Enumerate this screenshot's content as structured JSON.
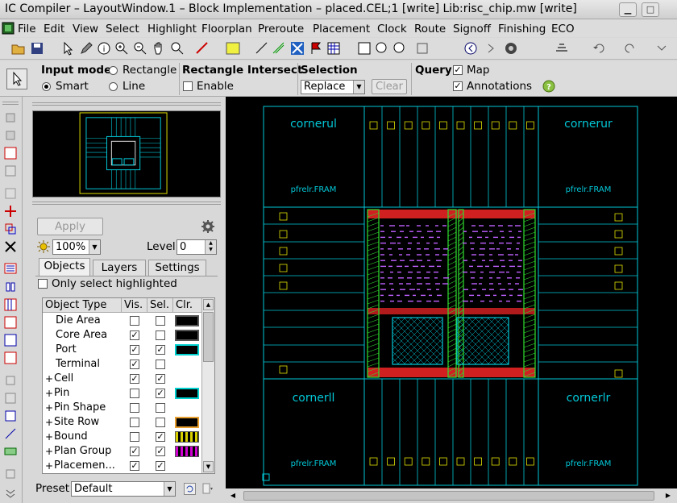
{
  "window": {
    "title": "IC Compiler – LayoutWindow.1 – Block Implementation – placed.CEL;1 [write]     Lib:risc_chip.mw [write]",
    "minimize_icon": "minimize-icon",
    "maximize_icon": "maximize-icon"
  },
  "menu": [
    "File",
    "Edit",
    "View",
    "Select",
    "Highlight",
    "Floorplan",
    "Preroute",
    "Placement",
    "Clock",
    "Route",
    "Signoff",
    "Finishing",
    "ECO"
  ],
  "options": {
    "input_mode_label": "Input mode",
    "rect_label": "Rectangle",
    "smart_label": "Smart",
    "line_label": "Line",
    "rect_intersect_label": "Rectangle Intersect",
    "enable_label": "Enable",
    "selection_label": "Selection",
    "selection_value": "Replace",
    "clear_label": "Clear",
    "query_label": "Query",
    "map_label": "Map",
    "annotations_label": "Annotations"
  },
  "panel": {
    "apply_label": "Apply",
    "zoom_value": "100%",
    "level_label": "Level",
    "level_value": "0",
    "tabs": [
      "Objects",
      "Layers",
      "Settings"
    ],
    "only_sel_label": "Only select highlighted",
    "columns": [
      "Object Type",
      "Vis.",
      "Sel.",
      "Clr."
    ],
    "rows": [
      {
        "name": "Die Area",
        "vis": false,
        "sel": false,
        "clr": "#000000",
        "exp": false
      },
      {
        "name": "Core Area",
        "vis": true,
        "sel": false,
        "clr": "#000000",
        "exp": false
      },
      {
        "name": "Port",
        "vis": true,
        "sel": true,
        "clr": "#00d0d0",
        "exp": false
      },
      {
        "name": "Terminal",
        "vis": true,
        "sel": false,
        "clr": "",
        "exp": false
      },
      {
        "name": "Cell",
        "vis": true,
        "sel": true,
        "clr": "",
        "exp": true
      },
      {
        "name": "Pin",
        "vis": false,
        "sel": true,
        "clr": "#00d0d0",
        "exp": true
      },
      {
        "name": "Pin Shape",
        "vis": false,
        "sel": false,
        "clr": "",
        "exp": true
      },
      {
        "name": "Site Row",
        "vis": false,
        "sel": false,
        "clr": "#e8a030",
        "exp": true
      },
      {
        "name": "Bound",
        "vis": false,
        "sel": true,
        "clr": "#d8d000",
        "exp": true
      },
      {
        "name": "Plan Group",
        "vis": true,
        "sel": true,
        "clr": "#d000d0",
        "exp": true
      },
      {
        "name": "Placemen...",
        "vis": true,
        "sel": true,
        "clr": "",
        "exp": true
      }
    ],
    "preset_label": "Preset",
    "preset_value": "Default"
  },
  "layout": {
    "corner_ul": "cornerul",
    "corner_ur": "cornerur",
    "corner_ll": "cornerll",
    "corner_lr": "cornerlr",
    "fram_label": "pfrelr.FRAM",
    "colors": {
      "cyan": "#00c8d8",
      "green": "#30e030",
      "red": "#d02020",
      "magenta": "#c060ff",
      "yellow": "#e0e000"
    }
  }
}
